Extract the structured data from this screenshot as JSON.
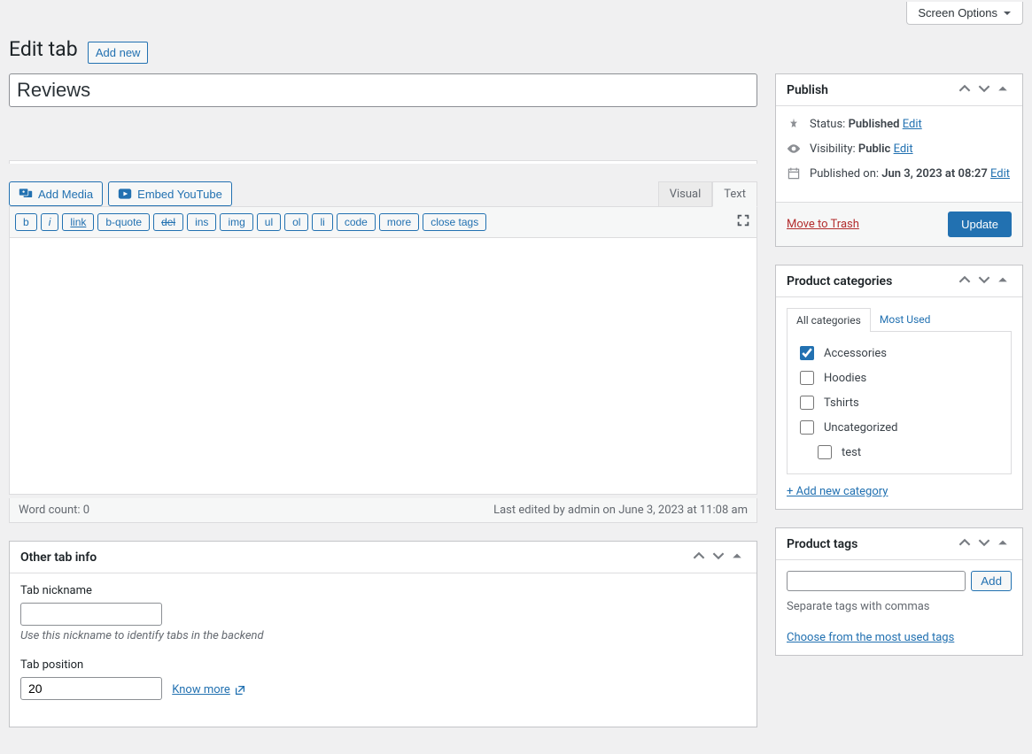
{
  "screen_options": "Screen Options",
  "page_title": "Edit tab",
  "add_new": "Add new",
  "title_value": "Reviews",
  "buttons": {
    "add_media": "Add Media",
    "embed_youtube": "Embed YouTube"
  },
  "editor_tabs": {
    "visual": "Visual",
    "text": "Text"
  },
  "quicktags": {
    "b": "b",
    "i": "i",
    "link": "link",
    "bquote": "b-quote",
    "del": "del",
    "ins": "ins",
    "img": "img",
    "ul": "ul",
    "ol": "ol",
    "li": "li",
    "code": "code",
    "more": "more",
    "close": "close tags"
  },
  "word_count": "Word count: 0",
  "last_edited": "Last edited by admin on June 3, 2023 at 11:08 am",
  "other_tab": {
    "title": "Other tab info",
    "nickname_label": "Tab nickname",
    "nickname_hint": "Use this nickname to identify tabs in the backend",
    "position_label": "Tab position",
    "position_value": "20",
    "know_more": "Know more "
  },
  "publish": {
    "title": "Publish",
    "status_label": "Status:",
    "status_value": "Published",
    "status_edit": "Edit",
    "visibility_label": "Visibility:",
    "visibility_value": "Public",
    "visibility_edit": "Edit",
    "published_label": "Published on:",
    "published_value": "Jun 3, 2023 at 08:27",
    "published_edit": "Edit",
    "trash": "Move to Trash",
    "update": "Update"
  },
  "categories": {
    "title": "Product categories",
    "tab_all": "All categories",
    "tab_most": "Most Used",
    "items": [
      {
        "label": "Accessories",
        "checked": true
      },
      {
        "label": "Hoodies",
        "checked": false
      },
      {
        "label": "Tshirts",
        "checked": false
      },
      {
        "label": "Uncategorized",
        "checked": false
      },
      {
        "label": "test",
        "checked": false,
        "indent": true
      }
    ],
    "add_new": "+ Add new category"
  },
  "tags": {
    "title": "Product tags",
    "add": "Add",
    "helper": "Separate tags with commas",
    "choose": "Choose from the most used tags"
  }
}
